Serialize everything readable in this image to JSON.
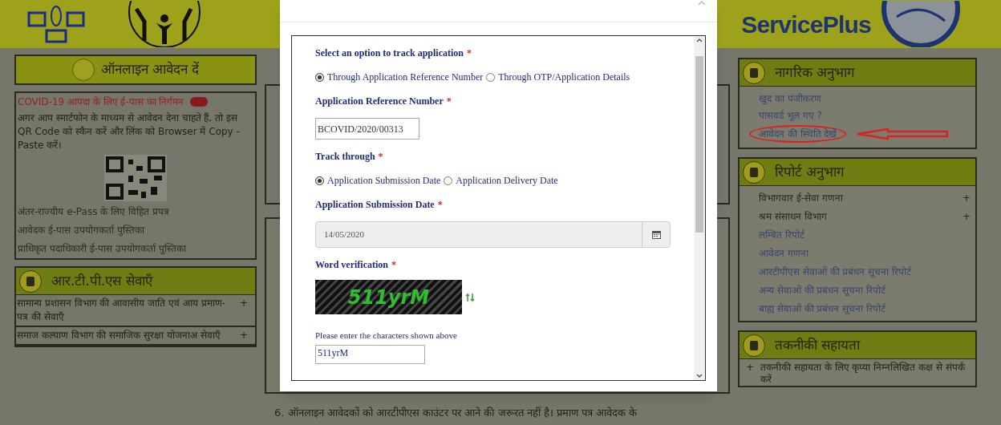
{
  "banner": {
    "brand": "ServicePlus"
  },
  "left": {
    "online": {
      "title": "ऑनलाइन आवेदन दें"
    },
    "notice": {
      "title": "COVID-19 आपदा के लिए ई-पास का निर्गमन",
      "text": "अगर आप स्मार्टफोन के माध्यम से आवेदन देना चाहते हैं, तो इस QR Code को स्कैन करें और लिंक को Browser में Copy - Paste करें।",
      "links": [
        "अंतर-राज्यीय e-Pass के लिए विहित प्रपत्र",
        "आवेदक ई-पास उपयोगकर्ता पुस्तिका",
        "प्राधिकृत पदाधिकारी ई-पास उपयोगकर्ता पुस्तिका"
      ]
    },
    "rtps": {
      "title": "आर.टी.पी.एस सेवाएँ",
      "items": [
        {
          "label": "सामान्य प्रशासन विभाग की आवासीय जाति एवं आय प्रमाण-पत्र की सेवाएँ",
          "expander": "+"
        },
        {
          "label": "समाज कल्याण विभाग की समाजिक सुरक्षा योजनाअ सेवाएँ",
          "expander": "+"
        }
      ]
    }
  },
  "center": {
    "note": "6. ऑनलाइन आवेदकों को आरटीपीएस काउंटर पर आने की जरूरत नहीं है। प्रमाण पत्र आवेदक के"
  },
  "right": {
    "citizen": {
      "title": "नागरिक अनुभाग",
      "links": [
        {
          "label": "खुद का पंजीकरण",
          "highlighted": false
        },
        {
          "label": "पासवर्ड भूल गए ?",
          "highlighted": false
        },
        {
          "label": "आवेदन की स्थिति देखें",
          "highlighted": true
        }
      ]
    },
    "reports": {
      "title": "रिपोर्ट अनुभाग",
      "items": [
        {
          "label": "विभागवार ई-सेवा गणना",
          "kind": "group",
          "expander": "+"
        },
        {
          "label": "श्रम संसाधन विभाग",
          "kind": "group",
          "expander": "+"
        },
        {
          "label": "लम्बित रिपोर्ट",
          "kind": "link"
        },
        {
          "label": "आवेदन गणना",
          "kind": "link"
        },
        {
          "label": "आरटीपीएस सेवाओं की प्रबंधन सूचना रिपोर्ट",
          "kind": "link"
        },
        {
          "label": "अन्य सेवाओं की प्रबंधन सूचना रिपोर्ट",
          "kind": "link"
        },
        {
          "label": "बाह्य सेवाओं की प्रबंधन सूचना रिपोर्ट",
          "kind": "link"
        }
      ]
    },
    "support": {
      "title": "तकनीकी सहायता",
      "items": [
        {
          "bullet": "+",
          "label": "तकनीकी सहायता के लिए कृप्या निम्नलिखित कक्ष से संपर्क करें"
        }
      ]
    }
  },
  "modal": {
    "option_label": {
      "text": "Select an option to track application",
      "mark": "*"
    },
    "options": [
      {
        "label": "Through Application Reference Number",
        "selected": true
      },
      {
        "label": "Through OTP/Application Details",
        "selected": false
      }
    ],
    "ref_label": {
      "text": "Application Reference Number",
      "mark": "*"
    },
    "ref_value": "BCOVID/2020/00313",
    "track_label": {
      "text": "Track through",
      "mark": "*"
    },
    "track_options": [
      {
        "label": "Application Submission Date",
        "selected": true
      },
      {
        "label": "Application Delivery Date",
        "selected": false
      }
    ],
    "date_label": {
      "text": "Application Submission Date",
      "mark": "*"
    },
    "date": {
      "value": "14/05/2020",
      "disabled": true
    },
    "word_label": {
      "text": "Word verification",
      "mark": "*"
    },
    "captcha": "511yrM",
    "hint": "Please enter the characters shown above",
    "answer": "511yrM"
  }
}
